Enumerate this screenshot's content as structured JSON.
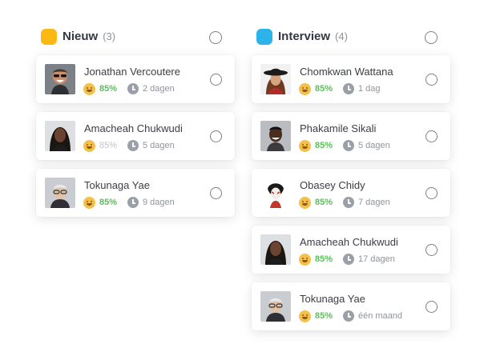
{
  "columns": [
    {
      "title": "Nieuw",
      "count": "(3)",
      "color": "#fdb813",
      "cards": [
        {
          "name": "Jonathan Vercoutere",
          "score": "85%",
          "score_faded": false,
          "time": "2 dagen",
          "avatar": "smiling-man-sunglasses"
        },
        {
          "name": "Amacheah Chukwudi",
          "score": "85%",
          "score_faded": true,
          "time": "5 dagen",
          "avatar": "woman-dark-hair"
        },
        {
          "name": "Tokunaga Yae",
          "score": "85%",
          "score_faded": false,
          "time": "9 dagen",
          "avatar": "person-glasses"
        }
      ]
    },
    {
      "title": "Interview",
      "count": "(4)",
      "color": "#2bb3ea",
      "cards": [
        {
          "name": "Chomkwan Wattana",
          "score": "85%",
          "score_faded": false,
          "time": "1 dag",
          "avatar": "woman-black-hat"
        },
        {
          "name": "Phakamile Sikali",
          "score": "85%",
          "score_faded": false,
          "time": "5 dagen",
          "avatar": "smiling-man"
        },
        {
          "name": "Obasey Chidy",
          "score": "85%",
          "score_faded": false,
          "time": "7 dagen",
          "avatar": "woman-face-paint"
        },
        {
          "name": "Amacheah Chukwudi",
          "score": "85%",
          "score_faded": false,
          "time": "17 dagen",
          "avatar": "woman-dark-hair"
        },
        {
          "name": "Tokunaga Yae",
          "score": "85%",
          "score_faded": false,
          "time": "één maand",
          "avatar": "person-glasses"
        }
      ]
    }
  ]
}
